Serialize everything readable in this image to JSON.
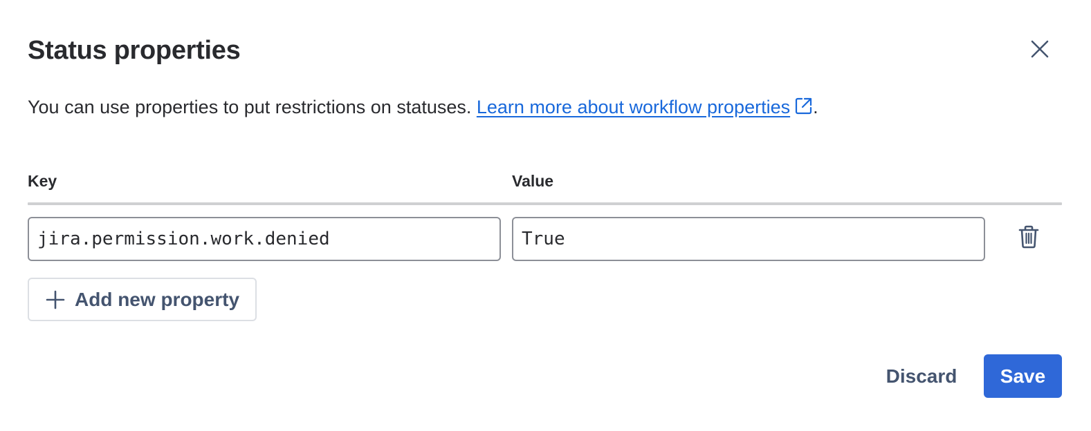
{
  "dialog": {
    "title": "Status properties",
    "close_icon": "close-icon",
    "description": {
      "text": "You can use properties to put restrictions on statuses. ",
      "link_text": "Learn more about workflow properties",
      "link_icon": "external-link-icon",
      "suffix": "."
    }
  },
  "table": {
    "headers": {
      "key": "Key",
      "value": "Value"
    },
    "rows": [
      {
        "key": "jira.permission.work.denied",
        "value": "True",
        "delete_icon": "trash-icon"
      }
    ]
  },
  "actions": {
    "add_label": "Add new property",
    "add_icon": "plus-icon",
    "discard_label": "Discard",
    "save_label": "Save"
  },
  "colors": {
    "link": "#1868db",
    "primary": "#2f68d8",
    "text": "#292a2e",
    "subtle_text": "#44546f"
  }
}
